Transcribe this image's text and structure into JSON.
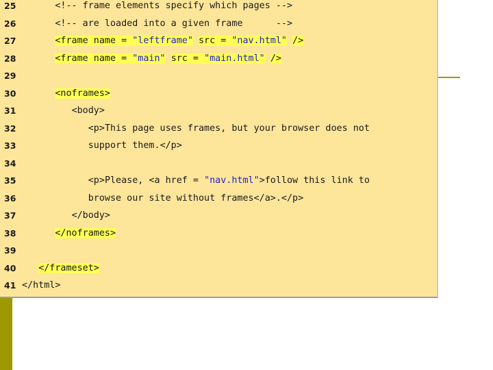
{
  "colors": {
    "panel_background": "#fde59a",
    "olive_accent": "#9c9a00",
    "string_color": "#2222cc",
    "highlight": "#ffff55"
  },
  "code_lines": [
    {
      "number": "25",
      "tokens": [
        {
          "text": "      <!-- frame elements specify which pages -->",
          "kind": "comment"
        }
      ]
    },
    {
      "number": "26",
      "tokens": [
        {
          "text": "      <!-- are loaded into a given frame      -->",
          "kind": "comment"
        }
      ]
    },
    {
      "number": "27",
      "tokens": [
        {
          "text": "      ",
          "kind": "text"
        },
        {
          "text": "<frame name = ",
          "kind": "tag",
          "hl": true
        },
        {
          "text": "\"leftframe\"",
          "kind": "str",
          "hl": true
        },
        {
          "text": " src = ",
          "kind": "attr",
          "hl": true
        },
        {
          "text": "\"nav.html\"",
          "kind": "str",
          "hl": true
        },
        {
          "text": " />",
          "kind": "tag",
          "hl": true
        }
      ]
    },
    {
      "number": "28",
      "tokens": [
        {
          "text": "      ",
          "kind": "text"
        },
        {
          "text": "<frame name = ",
          "kind": "tag",
          "hl": true
        },
        {
          "text": "\"main\"",
          "kind": "str",
          "hl": true
        },
        {
          "text": " src = ",
          "kind": "attr",
          "hl": true
        },
        {
          "text": "\"main.html\"",
          "kind": "str",
          "hl": true
        },
        {
          "text": " />",
          "kind": "tag",
          "hl": true
        }
      ]
    },
    {
      "number": "29",
      "tokens": []
    },
    {
      "number": "30",
      "tokens": [
        {
          "text": "      ",
          "kind": "text"
        },
        {
          "text": "<noframes>",
          "kind": "tag",
          "hl": true
        }
      ]
    },
    {
      "number": "31",
      "tokens": [
        {
          "text": "         <body>",
          "kind": "tag"
        }
      ]
    },
    {
      "number": "32",
      "tokens": [
        {
          "text": "            <p>",
          "kind": "tag"
        },
        {
          "text": "This page uses frames, but your browser does not",
          "kind": "text"
        }
      ]
    },
    {
      "number": "33",
      "tokens": [
        {
          "text": "            support them.",
          "kind": "text"
        },
        {
          "text": "</p>",
          "kind": "tag"
        }
      ]
    },
    {
      "number": "34",
      "tokens": []
    },
    {
      "number": "35",
      "tokens": [
        {
          "text": "            <p>",
          "kind": "tag"
        },
        {
          "text": "Please, ",
          "kind": "text"
        },
        {
          "text": "<a href = ",
          "kind": "tag"
        },
        {
          "text": "\"nav.html\"",
          "kind": "str"
        },
        {
          "text": ">",
          "kind": "tag"
        },
        {
          "text": "follow this link to",
          "kind": "text"
        }
      ]
    },
    {
      "number": "36",
      "tokens": [
        {
          "text": "            browse our site without frames",
          "kind": "text"
        },
        {
          "text": "</a>",
          "kind": "tag"
        },
        {
          "text": ".",
          "kind": "text"
        },
        {
          "text": "</p>",
          "kind": "tag"
        }
      ]
    },
    {
      "number": "37",
      "tokens": [
        {
          "text": "         </body>",
          "kind": "tag"
        }
      ]
    },
    {
      "number": "38",
      "tokens": [
        {
          "text": "      ",
          "kind": "text"
        },
        {
          "text": "</noframes>",
          "kind": "tag",
          "hl": true
        }
      ]
    },
    {
      "number": "39",
      "tokens": []
    },
    {
      "number": "40",
      "tokens": [
        {
          "text": "   </frameset>",
          "kind": "tag",
          "hl": true
        }
      ]
    },
    {
      "number": "41",
      "tokens": [
        {
          "text": "</html>",
          "kind": "tag"
        }
      ]
    }
  ]
}
